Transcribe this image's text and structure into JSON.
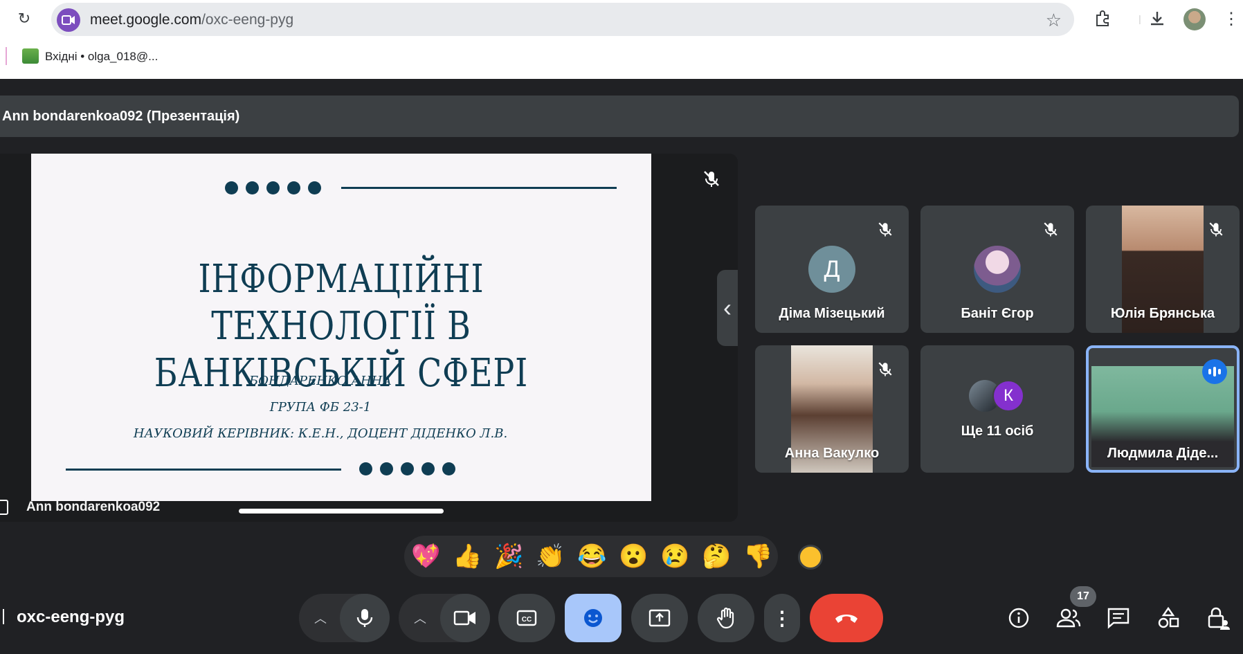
{
  "browser": {
    "url_host": "meet.google.com",
    "url_path": "/oxc-eeng-pyg",
    "bookmark_label": "Вхідні • olga_018@..."
  },
  "presentation": {
    "bar_title": "Ann bondarenkoa092 (Презентація)",
    "presenter_name": "Ann bondarenkoa092",
    "slide": {
      "title_line1": "ІНФОРМАЦІЙНІ ТЕХНОЛОГІЇ В",
      "title_line2": "БАНКІВСЬКІЙ СФЕРІ",
      "author": "БОНДАРЕНКО АННА",
      "group": "ГРУПА ФБ 23-1",
      "supervisor": "НАУКОВИЙ КЕРІВНИК: К.Е.Н., ДОЦЕНТ ДІДЕНКО Л.В."
    }
  },
  "participants": [
    {
      "name": "Діма Мізецький",
      "initial": "Д",
      "avatar_color": "#6f8f9a",
      "muted": true
    },
    {
      "name": "Баніт Єгор",
      "muted": true
    },
    {
      "name": "Юлія Брянська",
      "muted": true
    },
    {
      "name": "Анна Вакулко",
      "muted": true
    },
    {
      "name": "Ще 11 осіб",
      "initial": "К",
      "avatar_color": "#8430ce"
    },
    {
      "name": "Людмила Діде...",
      "speaking": true
    }
  ],
  "reactions": [
    "💖",
    "👍",
    "🎉",
    "👏",
    "😂",
    "😮",
    "😢",
    "🤔",
    "👎"
  ],
  "controls": {
    "meeting_code": "oxc-eeng-pyg",
    "participants_count": "17"
  },
  "colors": {
    "background": "#202124",
    "tile": "#3c4043",
    "active_control": "#a8c7fa",
    "hangup": "#ea4335",
    "speaking": "#8ab4f8",
    "slide_text": "#0f3d53"
  }
}
